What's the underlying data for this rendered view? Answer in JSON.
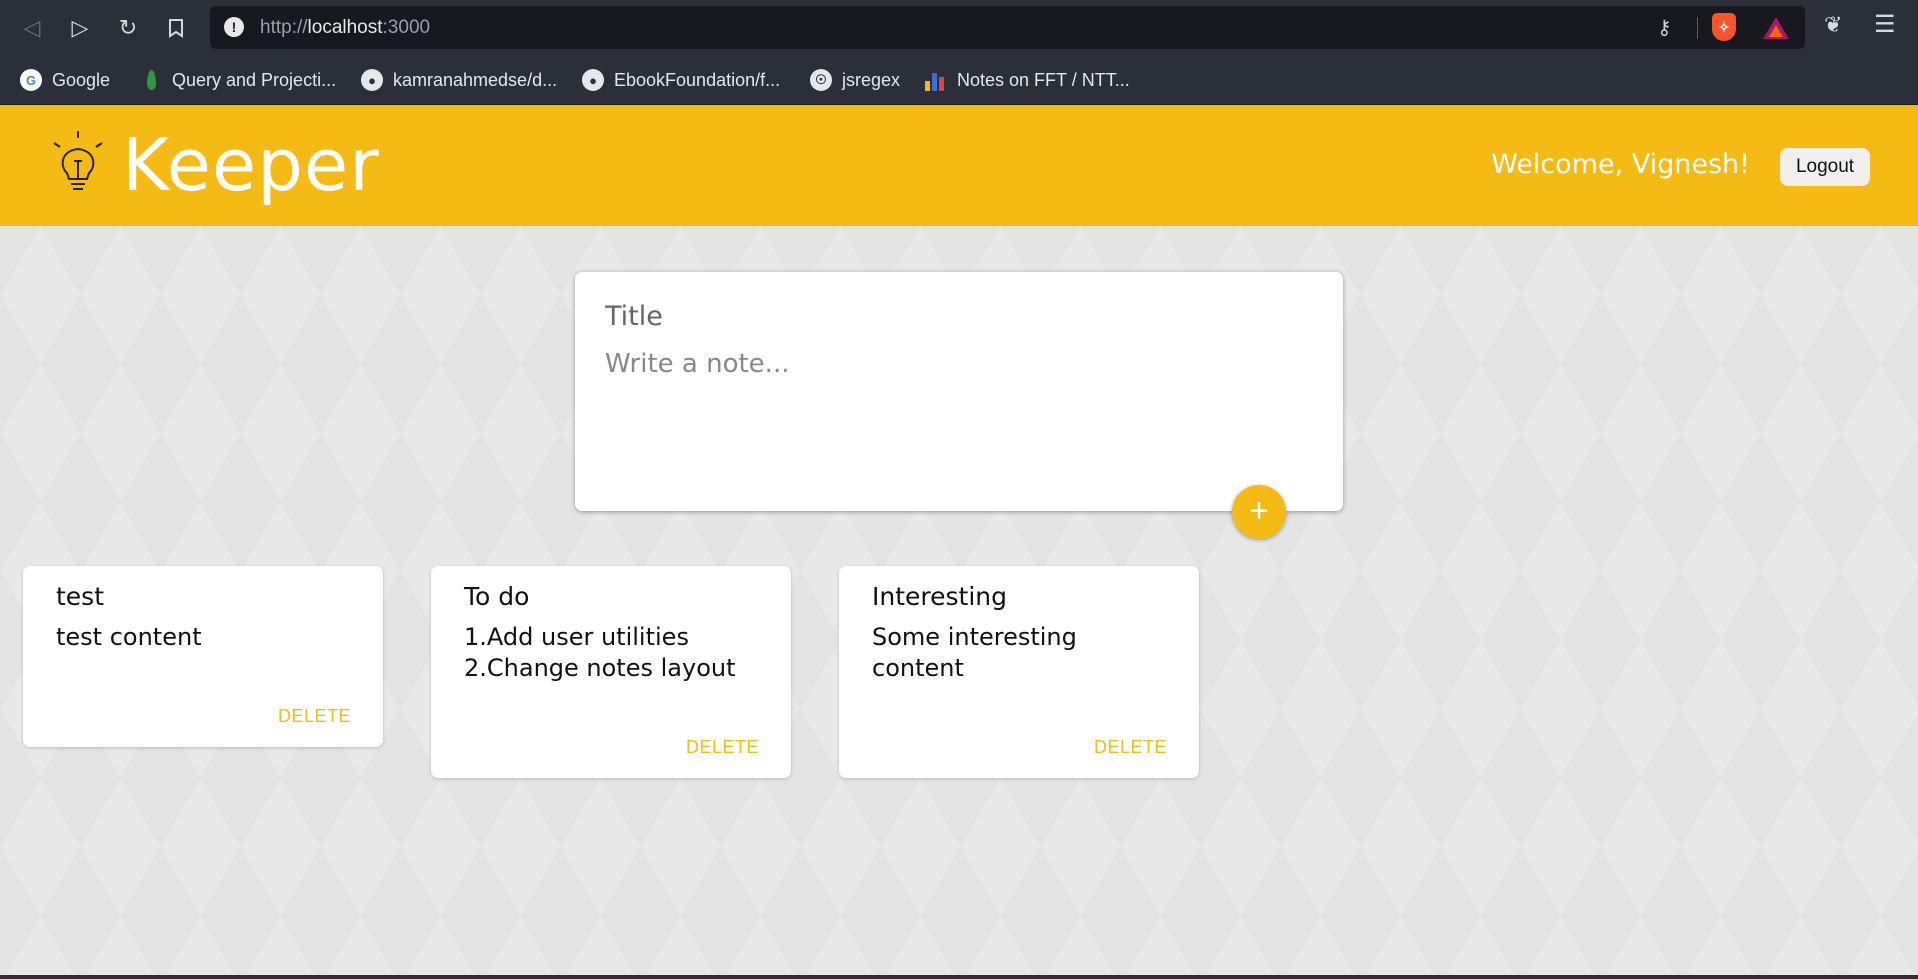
{
  "browser": {
    "url_scheme": "http://",
    "url_host": "localhost",
    "url_port": ":3000",
    "bookmarks": [
      {
        "label": "Google",
        "icon": "google-icon"
      },
      {
        "label": "Query and Projecti...",
        "icon": "mongodb-leaf-icon"
      },
      {
        "label": "kamranahmedse/d...",
        "icon": "github-icon"
      },
      {
        "label": "EbookFoundation/f...",
        "icon": "github-icon"
      },
      {
        "label": "jsregex",
        "icon": "globe-icon"
      },
      {
        "label": "Notes on FFT / NTT...",
        "icon": "bar-chart-icon"
      }
    ]
  },
  "header": {
    "app_title": "Keeper",
    "welcome": "Welcome, Vignesh!",
    "logout_label": "Logout",
    "accent_color": "#f5ba13"
  },
  "create_note": {
    "title_placeholder": "Title",
    "content_placeholder": "Write a note...",
    "add_label": "+"
  },
  "notes": [
    {
      "title": "test",
      "content": "test content",
      "delete_label": "DELETE"
    },
    {
      "title": "To do",
      "content": "1.Add user utilities\n2.Change notes layout",
      "delete_label": "DELETE"
    },
    {
      "title": "Interesting",
      "content": "Some interesting\ncontent",
      "delete_label": "DELETE"
    }
  ]
}
